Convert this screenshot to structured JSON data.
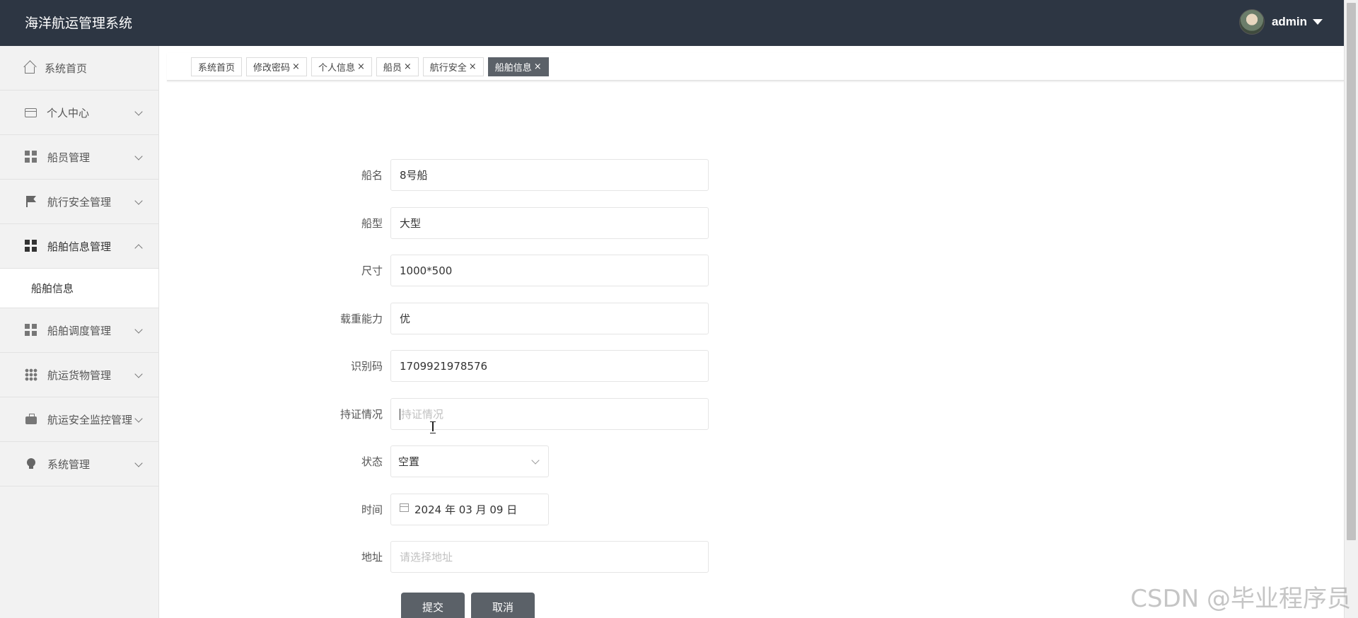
{
  "header": {
    "title": "海洋航运管理系统",
    "username": "admin"
  },
  "sidebar": {
    "items": [
      {
        "label": "系统首页",
        "icon": "home-icon"
      },
      {
        "label": "个人中心",
        "icon": "card-icon"
      },
      {
        "label": "船员管理",
        "icon": "grid-icon"
      },
      {
        "label": "航行安全管理",
        "icon": "flag-icon"
      },
      {
        "label": "船舶信息管理",
        "icon": "grid-icon",
        "expanded": true
      },
      {
        "label": "船舶调度管理",
        "icon": "grid-icon"
      },
      {
        "label": "航运货物管理",
        "icon": "apps-icon"
      },
      {
        "label": "航运安全监控管理",
        "icon": "briefcase-icon"
      },
      {
        "label": "系统管理",
        "icon": "bulb-icon"
      }
    ],
    "sub_item": "船舶信息"
  },
  "tabs": [
    {
      "label": "系统首页",
      "closable": false
    },
    {
      "label": "修改密码",
      "closable": true
    },
    {
      "label": "个人信息",
      "closable": true
    },
    {
      "label": "船员",
      "closable": true
    },
    {
      "label": "航行安全",
      "closable": true
    },
    {
      "label": "船舶信息",
      "closable": true,
      "active": true
    }
  ],
  "tab_close": "×",
  "form": {
    "name_label": "船名",
    "name_value": "8号船",
    "type_label": "船型",
    "type_value": "大型",
    "size_label": "尺寸",
    "size_value": "1000*500",
    "capacity_label": "载重能力",
    "capacity_value": "优",
    "id_label": "识别码",
    "id_value": "1709921978576",
    "cert_label": "持证情况",
    "cert_placeholder": "持证情况",
    "status_label": "状态",
    "status_value": "空置",
    "time_label": "时间",
    "time_value": "2024 年 03 月 09 日",
    "address_label": "地址",
    "address_placeholder": "请选择地址",
    "submit_label": "提交",
    "cancel_label": "取消"
  },
  "watermark": "CSDN @毕业程序员",
  "colors": {
    "header_bg": "#2d3643",
    "button_bg": "#5b6168",
    "active_tab_bg": "#5b6168"
  }
}
